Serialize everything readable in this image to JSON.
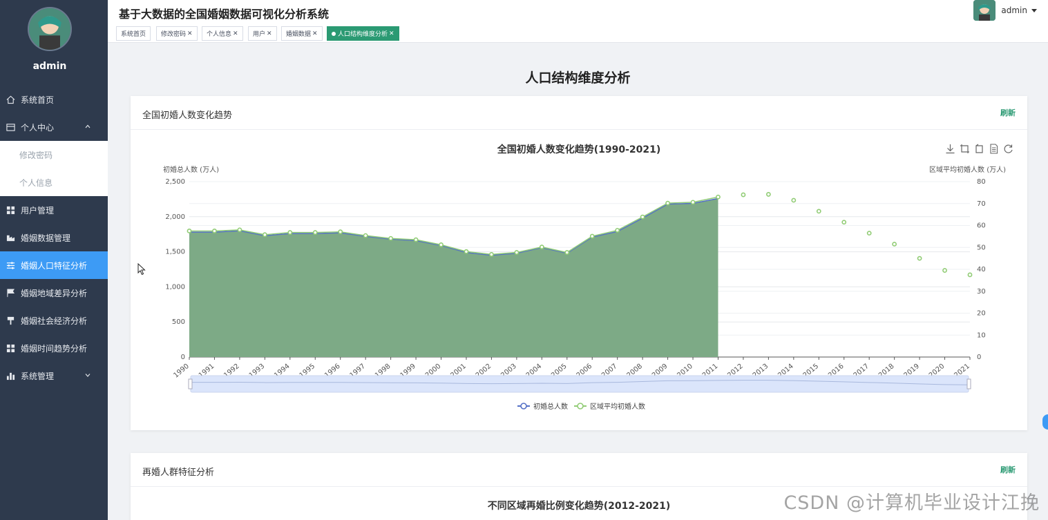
{
  "sidebar": {
    "username": "admin",
    "items": [
      {
        "label": "系统首页",
        "icon": "home-icon"
      },
      {
        "label": "个人中心",
        "icon": "user-card-icon",
        "expanded": true
      },
      {
        "label": "修改密码",
        "sub": true
      },
      {
        "label": "个人信息",
        "sub": true
      },
      {
        "label": "用户管理",
        "icon": "grid-icon"
      },
      {
        "label": "婚姻数据管理",
        "icon": "data-icon"
      },
      {
        "label": "婚姻人口特征分析",
        "icon": "sliders-icon",
        "active": true
      },
      {
        "label": "婚姻地域差异分析",
        "icon": "flag-icon"
      },
      {
        "label": "婚姻社会经济分析",
        "icon": "cup-icon"
      },
      {
        "label": "婚姻时间趋势分析",
        "icon": "grid-icon"
      },
      {
        "label": "系统管理",
        "icon": "bar-chart-icon"
      }
    ]
  },
  "header": {
    "title": "基于大数据的全国婚姻数据可视化分析系统",
    "user": "admin"
  },
  "tags": [
    {
      "label": "系统首页",
      "closable": false
    },
    {
      "label": "修改密码",
      "closable": true
    },
    {
      "label": "个人信息",
      "closable": true
    },
    {
      "label": "用户",
      "closable": true
    },
    {
      "label": "婚姻数据",
      "closable": true
    },
    {
      "label": "人口结构维度分析",
      "closable": true,
      "active": true
    }
  ],
  "page": {
    "title": "人口结构维度分析"
  },
  "card1": {
    "title": "全国初婚人数变化趋势",
    "refresh": "刷新"
  },
  "card2": {
    "title": "再婚人群特征分析",
    "refresh": "刷新",
    "chart_title": "不同区域再婚比例变化趋势(2012-2021)"
  },
  "watermark": "CSDN @计算机毕业设计江挽",
  "colors": {
    "sidebar_bg": "#2e3a4d",
    "active_menu": "#3d9bf5",
    "accent_green": "#2b9a73",
    "area_fill": "#7daa86",
    "line_series1": "#5470c6",
    "line_series2": "#91cc75"
  },
  "chart_data": {
    "type": "line",
    "title": "全国初婚人数变化趋势(1990-2021)",
    "ylabel_left": "初婚总人数 (万人)",
    "ylabel_right": "区域平均初婚人数 (万人)",
    "ylim_left": [
      0,
      2500
    ],
    "ylim_right": [
      0,
      80
    ],
    "yticks_left": [
      "0",
      "500",
      "1,000",
      "1,500",
      "2,000",
      "2,500"
    ],
    "yticks_right": [
      "0",
      "10",
      "20",
      "30",
      "40",
      "50",
      "60",
      "70",
      "80"
    ],
    "categories": [
      "1990",
      "1991",
      "1992",
      "1993",
      "1994",
      "1995",
      "1996",
      "1997",
      "1998",
      "1999",
      "2000",
      "2001",
      "2002",
      "2003",
      "2004",
      "2005",
      "2006",
      "2007",
      "2008",
      "2009",
      "2010",
      "2011",
      "2012",
      "2013",
      "2014",
      "2015",
      "2016",
      "2017",
      "2018",
      "2019",
      "2020",
      "2021"
    ],
    "legend": [
      "初婚总人数",
      "区域平均初婚人数"
    ],
    "legend_position": "bottom",
    "series": [
      {
        "name": "初婚总人数",
        "axis": "left",
        "area": true,
        "values": [
          1780,
          1780,
          1800,
          1730,
          1760,
          1760,
          1770,
          1720,
          1680,
          1660,
          1590,
          1490,
          1450,
          1480,
          1560,
          1480,
          1710,
          1790,
          1980,
          2180,
          2190,
          2260,
          null,
          null,
          null,
          null,
          null,
          null,
          null,
          null,
          null,
          null
        ]
      },
      {
        "name": "区域平均初婚人数",
        "axis": "right",
        "values": [
          57.5,
          57.5,
          58.0,
          55.8,
          56.8,
          56.8,
          57.1,
          55.4,
          54.1,
          53.5,
          51.2,
          48.1,
          46.8,
          47.7,
          50.2,
          47.7,
          55.1,
          57.8,
          63.9,
          70.2,
          70.6,
          73.0,
          74.0,
          74.2,
          71.5,
          66.5,
          61.5,
          56.5,
          51.5,
          45.0,
          39.5,
          37.5
        ]
      }
    ]
  }
}
